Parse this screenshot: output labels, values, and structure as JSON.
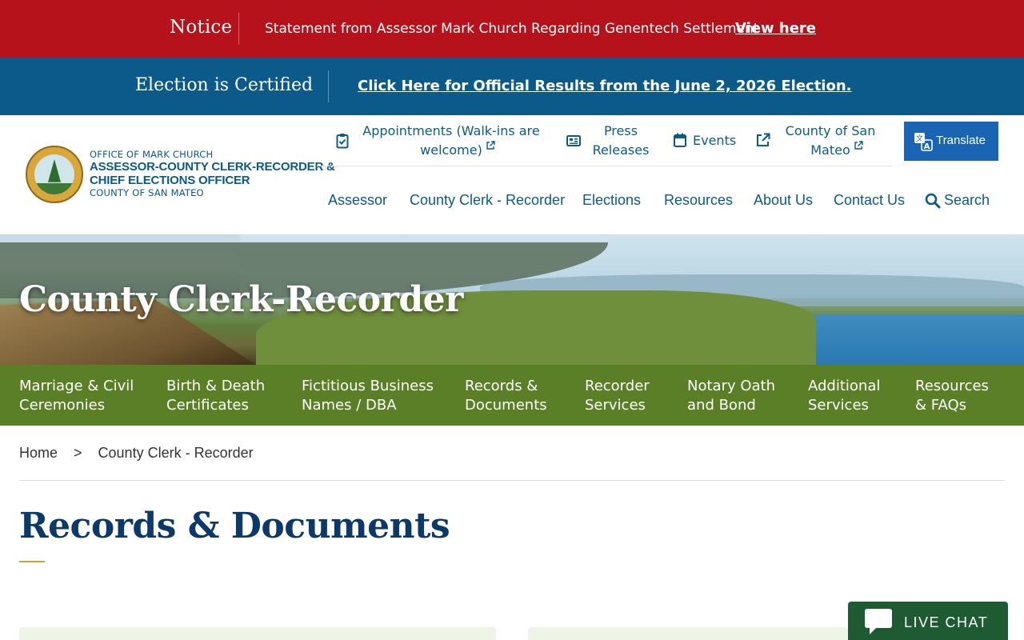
{
  "notice": {
    "label": "Notice",
    "text": "Statement from Assessor Mark Church Regarding Genentech Settlement",
    "link": "View here"
  },
  "election": {
    "label": "Election is Certified",
    "link": "Click Here for Official Results from the June 2, 2026 Election."
  },
  "logo": {
    "line1": "OFFICE OF MARK CHURCH",
    "line2": "ASSESSOR-COUNTY CLERK-RECORDER &",
    "line3": "CHIEF ELECTIONS OFFICER",
    "line4": "COUNTY OF SAN MATEO"
  },
  "utility_nav": {
    "appointments_1": "Appointments (Walk-ins are",
    "appointments_2": "welcome)",
    "press_1": "Press",
    "press_2": "Releases",
    "events": "Events",
    "county_1": "County of San",
    "county_2": "Mateo",
    "translate": "Translate"
  },
  "main_nav": {
    "assessor": "Assessor",
    "clerk": "County Clerk - Recorder",
    "elections": "Elections",
    "resources": "Resources",
    "about": "About Us",
    "contact": "Contact Us",
    "search": "Search"
  },
  "hero": {
    "title": "County Clerk-Recorder"
  },
  "sub_nav": [
    {
      "line1": "Marriage & Civil",
      "line2": "Ceremonies"
    },
    {
      "line1": "Birth & Death",
      "line2": "Certificates"
    },
    {
      "line1": "Fictitious Business",
      "line2": "Names / DBA"
    },
    {
      "line1": "Records &",
      "line2": "Documents"
    },
    {
      "line1": "Recorder",
      "line2": "Services"
    },
    {
      "line1": "Notary Oath",
      "line2": "and Bond"
    },
    {
      "line1": "Additional",
      "line2": "Services"
    },
    {
      "line1": "Resources",
      "line2": "& FAQs"
    }
  ],
  "breadcrumb": {
    "home": "Home",
    "sep": ">",
    "current": "County Clerk - Recorder"
  },
  "page": {
    "title": "Records & Documents"
  },
  "chat": {
    "label": "LIVE CHAT"
  },
  "colors": {
    "notice_red": "#b5121b",
    "election_blue": "#0b5a8a",
    "subnav_green": "#5a7f27",
    "title_navy": "#0b3a6a",
    "accent_gold": "#d5a02a",
    "chat_green": "#1e5b32"
  }
}
